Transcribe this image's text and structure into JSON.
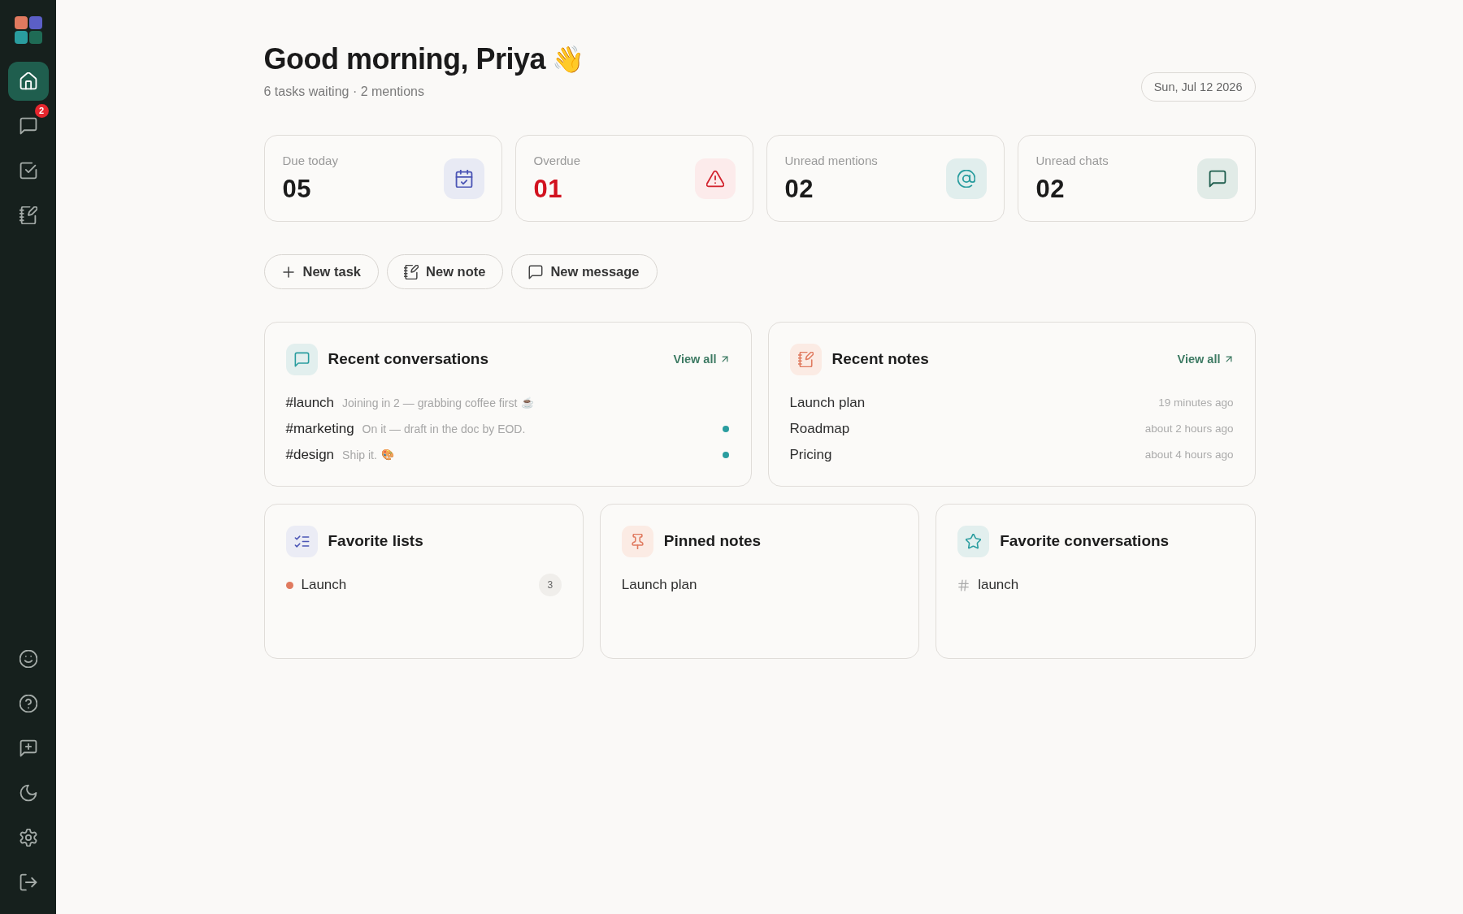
{
  "sidebar": {
    "nav": [
      {
        "kind": "home",
        "selected": true
      },
      {
        "kind": "messages",
        "selected": false,
        "badge": "2"
      },
      {
        "kind": "tasks",
        "selected": false
      },
      {
        "kind": "notes",
        "selected": false
      }
    ],
    "footer": [
      {
        "kind": "emoji"
      },
      {
        "kind": "help"
      },
      {
        "kind": "feedback"
      },
      {
        "kind": "theme"
      },
      {
        "kind": "settings"
      },
      {
        "kind": "logout"
      }
    ]
  },
  "header": {
    "greeting": "Good morning, Priya",
    "emoji": "👋",
    "summary": "6 tasks waiting · 2 mentions",
    "date": "Sun, Jul 12 2026"
  },
  "stats": [
    {
      "kind": "due",
      "label": "Due today",
      "value": "05"
    },
    {
      "kind": "overdue",
      "label": "Overdue",
      "value": "01"
    },
    {
      "kind": "mentions",
      "label": "Unread mentions",
      "value": "02"
    },
    {
      "kind": "chats",
      "label": "Unread chats",
      "value": "02"
    }
  ],
  "actions": [
    {
      "kind": "task",
      "label": "New task"
    },
    {
      "kind": "note",
      "label": "New note"
    },
    {
      "kind": "message",
      "label": "New message"
    }
  ],
  "recent": [
    {
      "kind": "conversations",
      "title": "Recent conversations",
      "link": "View all",
      "items": [
        {
          "channel": "#launch",
          "preview": "Joining in 2 — grabbing coffee first",
          "emoji": "☕",
          "unread": false
        },
        {
          "channel": "#marketing",
          "preview": "On it — draft in the doc by EOD.",
          "unread": true
        },
        {
          "channel": "#design",
          "preview": "Ship it.",
          "emoji": "🎨",
          "unread": true
        }
      ]
    },
    {
      "kind": "notes",
      "title": "Recent notes",
      "link": "View all",
      "items": [
        {
          "title": "Launch plan",
          "time": "19 minutes ago"
        },
        {
          "title": "Roadmap",
          "time": "about 2 hours ago"
        },
        {
          "title": "Pricing",
          "time": "about 4 hours ago"
        }
      ]
    }
  ],
  "favorites": [
    {
      "kind": "lists",
      "title": "Favorite lists",
      "items": [
        {
          "name": "Launch",
          "color": "#e07a5f",
          "count": "3"
        }
      ]
    },
    {
      "kind": "pinned",
      "title": "Pinned notes",
      "items": [
        {
          "title": "Launch plan"
        }
      ]
    },
    {
      "kind": "channels",
      "title": "Favorite conversations",
      "items": [
        {
          "name": "launch"
        }
      ]
    }
  ]
}
